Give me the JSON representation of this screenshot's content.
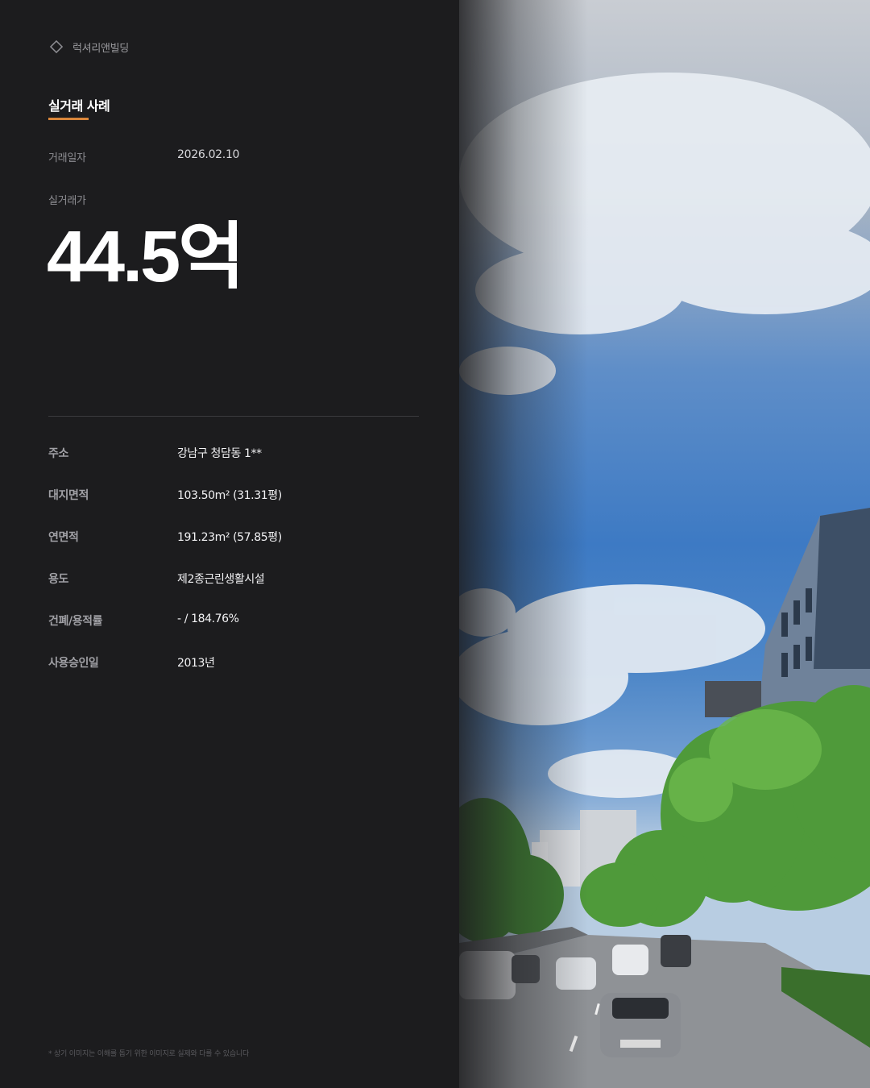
{
  "brand": {
    "name": "럭셔리앤빌딩",
    "icon": "diamond-outline-icon"
  },
  "section": {
    "title": "실거래 사례"
  },
  "transaction": {
    "date_label": "거래일자",
    "date_value": "2026.02.10",
    "price_label": "실거래가",
    "price_value": "44.5억"
  },
  "details": [
    {
      "label": "주소",
      "value": "강남구 청담동 1**"
    },
    {
      "label": "대지면적",
      "value": "103.50m² (31.31평)"
    },
    {
      "label": "연면적",
      "value": "191.23m² (57.85평)"
    },
    {
      "label": "용도",
      "value": "제2종근린생활시설"
    },
    {
      "label": "건폐/용적률",
      "value": "- / 184.76%"
    },
    {
      "label": "사용승인일",
      "value": "2013년"
    }
  ],
  "footnote": "* 상기 이미지는 이해를 돕기 위한 이미지로 실제와 다를 수 있습니다",
  "colors": {
    "accent": "#d9863a",
    "background": "#1c1c1e"
  }
}
